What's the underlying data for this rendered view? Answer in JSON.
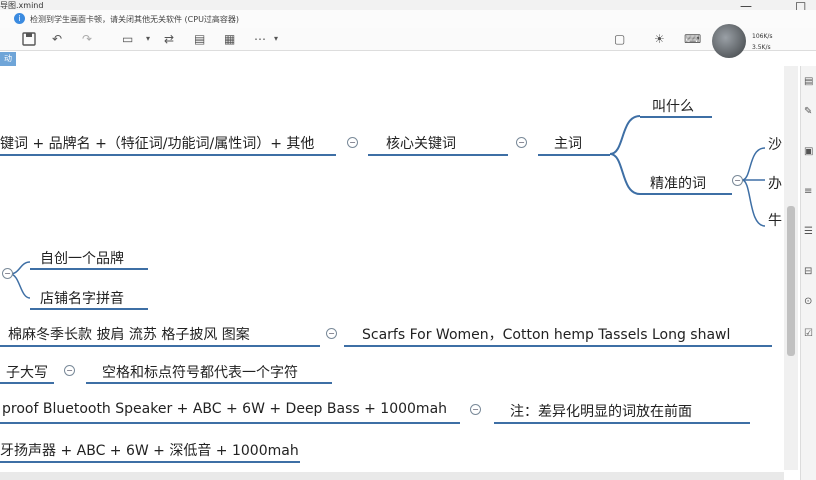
{
  "window": {
    "title": "导图.xmind",
    "controls": {
      "minimize": "—",
      "maximize": "□"
    }
  },
  "notice": {
    "icon": "info-icon",
    "text": "检测到学生画面卡顿，请关闭其他无关软件 (CPU过高容器)"
  },
  "toolbar": {
    "items": [
      "save-icon",
      "undo-icon",
      "redo-icon",
      "layout-icon",
      "dropdown",
      "structure-icon",
      "format-icon",
      "export-icon",
      "more-icon"
    ]
  },
  "net_widget": {
    "up": "106K/s",
    "down": "3.5K/s"
  },
  "side_tab": {
    "label": "动"
  },
  "mindmap": {
    "formula": "键词 + 品牌名 +（特征词/功能词/属性词）+ 其他",
    "core_keyword": "核心关键词",
    "main_word": "主词",
    "what_called": "叫什么",
    "precise_word": "精准的词",
    "precise_children": [
      "沙",
      "办",
      "牛"
    ],
    "brand_options": [
      "自创一个品牌",
      "店铺名字拼音"
    ],
    "chinese_product": "棉麻冬季长款 披肩 流苏 格子披风 图案",
    "english_product": "Scarfs For Women，Cotton hemp Tassels Long shawl",
    "capital_rule": "子大写",
    "space_rule": "空格和标点符号都代表一个字符",
    "english_spec": "proof Bluetooth Speaker + ABC + 6W + Deep Bass + 1000mah",
    "note": "注：差异化明显的词放在前面",
    "chinese_spec": "牙扬声器 + ABC + 6W + 深低音 + 1000mah"
  },
  "colors": {
    "branch_line": "#3e6fa5",
    "accent": "#6fa5d8"
  }
}
